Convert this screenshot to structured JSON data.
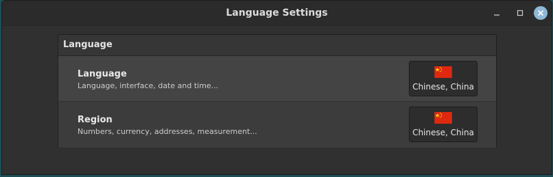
{
  "window": {
    "title": "Language Settings",
    "controls": {
      "minimize_icon": "minimize-icon",
      "maximize_icon": "maximize-icon",
      "close_icon": "close-icon"
    }
  },
  "section": {
    "header": "Language",
    "rows": [
      {
        "title": "Language",
        "subtitle": "Language, interface, date and time...",
        "value": "Chinese, China",
        "flag_icon": "china-flag-icon"
      },
      {
        "title": "Region",
        "subtitle": "Numbers, currency, addresses, measurement...",
        "value": "Chinese, China",
        "flag_icon": "china-flag-icon"
      }
    ]
  },
  "colors": {
    "close_button": "#8fb8d6",
    "flag_red": "#de2910",
    "flag_star": "#ffde00"
  }
}
